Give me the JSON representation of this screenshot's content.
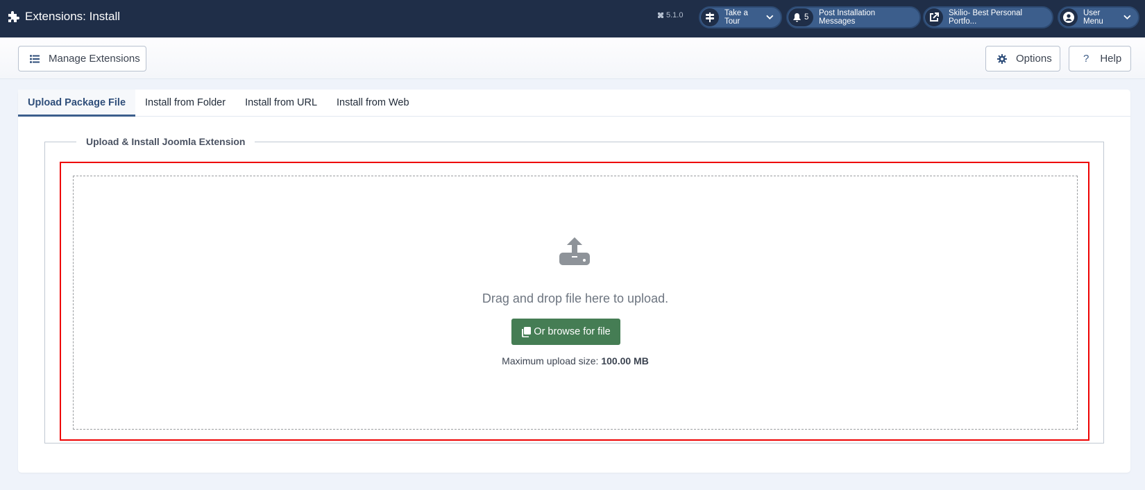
{
  "header": {
    "title": "Extensions: Install",
    "version": "5.1.0",
    "take_tour": "Take a Tour",
    "messages_count": "5",
    "messages_label": "Post Installation Messages",
    "site_link": "Skilio- Best Personal Portfo...",
    "user_menu": "User Menu"
  },
  "toolbar": {
    "manage_label": "Manage Extensions",
    "options_label": "Options",
    "help_label": "Help",
    "help_glyph": "?"
  },
  "tabs": [
    {
      "label": "Upload Package File",
      "active": true
    },
    {
      "label": "Install from Folder",
      "active": false
    },
    {
      "label": "Install from URL",
      "active": false
    },
    {
      "label": "Install from Web",
      "active": false
    }
  ],
  "upload": {
    "legend": "Upload & Install Joomla Extension",
    "drop_text": "Drag and drop file here to upload.",
    "browse_label": "Or browse for file",
    "max_label": "Maximum upload size:",
    "max_value": "100.00 MB"
  },
  "colors": {
    "header_bg": "#1f2e48",
    "pill_bg": "#3c5e8c",
    "browse_bg": "#457d54",
    "highlight": "#ee0000"
  }
}
